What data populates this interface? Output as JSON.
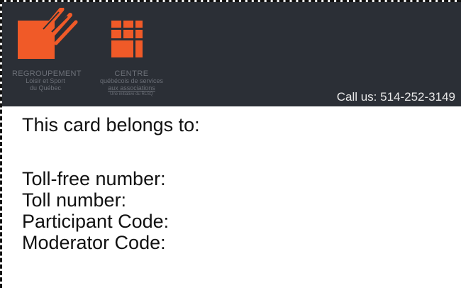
{
  "header": {
    "org1": {
      "line1": "REGROUPEMENT",
      "line2": "Loisir et Sport",
      "line3": "du Québec",
      "logo_icon": "rlsq-claw-logo-icon"
    },
    "org2": {
      "line1": "CENTRE",
      "line2": "québécois de services",
      "line3": "aux associations",
      "line4": "Une initiative du RLSQ",
      "logo_icon": "grid-blocks-logo-icon"
    },
    "call_text": "Call us: 514-252-3149"
  },
  "card": {
    "belongs_to": "This card belongs to:",
    "toll_free": "Toll-free number:",
    "toll": "Toll number:",
    "participant": "Participant Code:",
    "moderator": "Moderator Code:"
  },
  "colors": {
    "header_bg": "#2b2f36",
    "accent": "#f05a28"
  }
}
